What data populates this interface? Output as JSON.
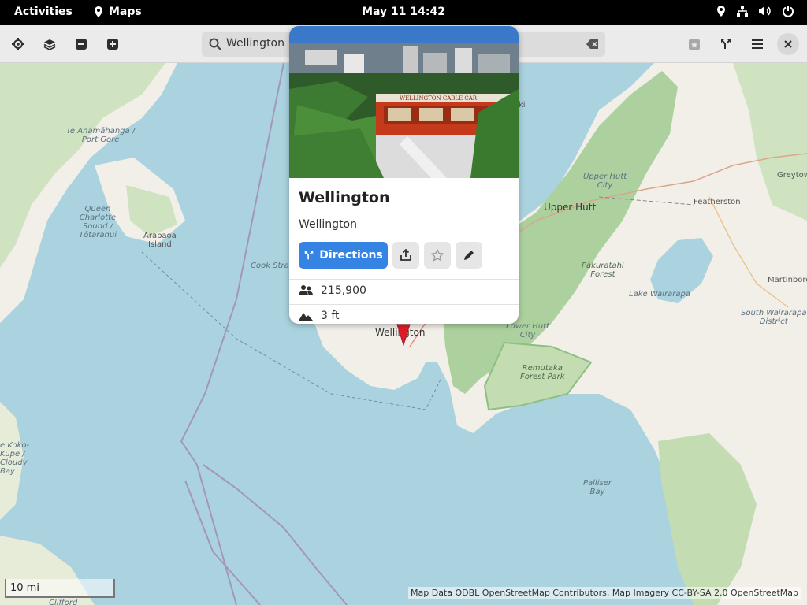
{
  "topbar": {
    "activities": "Activities",
    "app_name": "Maps",
    "clock": "May 11  14:42"
  },
  "header": {
    "search_value": "Wellington"
  },
  "place": {
    "title": "Wellington",
    "subtitle": "Wellington",
    "directions_label": "Directions",
    "population": "215,900",
    "altitude": "3 ft",
    "photo_sign_text": "WELLINGTON CABLE CAR"
  },
  "map": {
    "labels": {
      "te_anamahanga": "Te Anamāhanga /\nPort Gore",
      "queen_charlotte": "Queen\nCharlotte\nSound /\nTōtaranui",
      "arapaoa": "Arapaoa\nIsland",
      "cook_strait": "Cook Strait",
      "wellington": "Wellington",
      "upper_hutt_city": "Upper Hutt\nCity",
      "upper_hutt": "Upper Hutt",
      "featherston": "Featherston",
      "greytown": "Greytow",
      "martinborough": "Martinboro",
      "pakuratahi": "Pākuratahi\nForest",
      "lake_wairarapa": "Lake Wairarapa",
      "south_wairarapa": "South Wairarapa\nDistrict",
      "lower_hutt": "Lower Hutt\nCity",
      "remutaka": "Remutaka\nForest Park",
      "palliser": "Palliser\nBay",
      "koko_kupe": "e Koko-\nKupe /\nCloudy\nBay",
      "clifford": "Clifford",
      "ki": "ki"
    },
    "scale": "10 mi",
    "attribution": "Map Data ODBL OpenStreetMap Contributors, Map Imagery CC-BY-SA 2.0 OpenStreetMap"
  },
  "colors": {
    "accent": "#3584e4",
    "water": "#aad3df",
    "land": "#f2efe9",
    "forest": "#add19e",
    "marker": "#e01b24"
  }
}
